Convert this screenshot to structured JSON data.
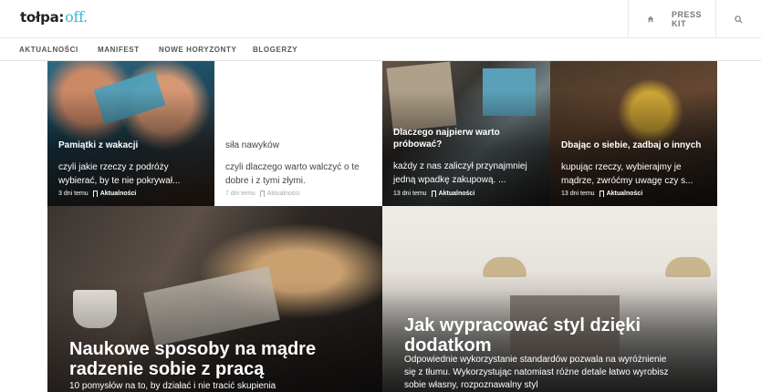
{
  "logo": {
    "brand": "tołpa:",
    "suffix": "off."
  },
  "topnav": {
    "press_kit": "PRESS KIT"
  },
  "nav": {
    "items": [
      "AKTUALNOŚCI",
      "MANIFEST",
      "NOWE HORYZONTY",
      "BLOGERZY"
    ]
  },
  "cards": [
    {
      "title": "Pamiątki z wakacji",
      "excerpt": "czyli jakie rzeczy z podróży wybierać, by te nie pokrywał...",
      "date": "3 dni temu",
      "category": "Aktualności"
    },
    {
      "title": "siła nawyków",
      "excerpt": "czyli dlaczego warto walczyć o te dobre i z tymi złymi.",
      "date": "7 dni temu",
      "category": "Aktualności"
    },
    {
      "title": "Dlaczego najpierw warto próbować?",
      "excerpt": "każdy z nas zaliczył przynajmniej jedną wpadkę zakupową. ...",
      "date": "13 dni temu",
      "category": "Aktualności"
    },
    {
      "title": "Dbając o siebie, zadbaj o innych",
      "excerpt": "kupując rzeczy, wybierajmy je mądrze, zwróćmy uwagę czy s...",
      "date": "13 dni temu",
      "category": "Aktualności"
    }
  ],
  "big_cards": [
    {
      "title": "Naukowe sposoby na mądre radzenie sobie z pracą",
      "excerpt": "10 pomysłów na to, by działać i nie tracić skupienia"
    },
    {
      "title": "Jak wypracować styl dzięki dodatkom",
      "excerpt": "Odpowiednie wykorzystanie standardów pozwala na wyróżnienie się z tłumu. Wykorzystując natomiast różne detale łatwo wyrobisz sobie własny, rozpoznawalny styl"
    }
  ],
  "colors": {
    "accent": "#3fb3d1",
    "card_text": "#ffffff"
  },
  "icons": {
    "home": "home-icon",
    "search": "search-icon",
    "bookmark": "bookmark-icon"
  }
}
